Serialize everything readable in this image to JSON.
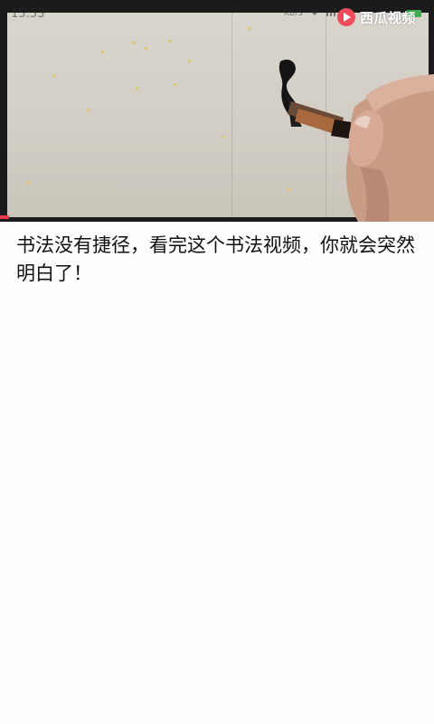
{
  "status_bar": {
    "time": "15:53",
    "network_speed": "KB/S"
  },
  "watermark": {
    "brand": "西瓜视频",
    "logo_color": "#f04b5a"
  },
  "video": {
    "scene": "calligraphy brush writing on xuan paper",
    "progress": 0.02
  },
  "title": "书法没有捷径，看完这个书法视频，你就会突然明白了！",
  "colors": {
    "accent": "#e83a4a",
    "battery": "#3cae4a"
  }
}
